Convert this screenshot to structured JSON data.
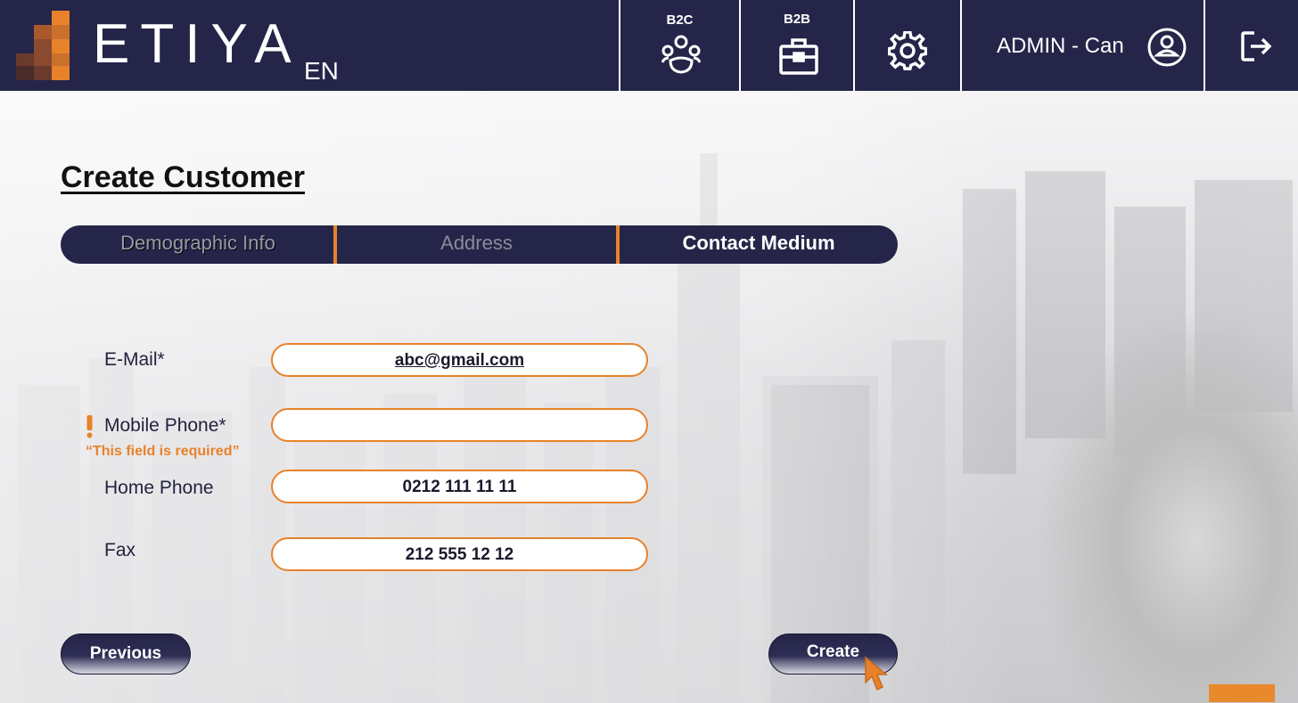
{
  "header": {
    "brand": "ETIYA",
    "language": "EN",
    "nav": {
      "b2c_label": "B2C",
      "b2b_label": "B2B"
    },
    "user_label": "ADMIN - Can",
    "icons": [
      "users-icon",
      "briefcase-icon",
      "gear-icon",
      "user-circle-icon",
      "logout-icon"
    ]
  },
  "page": {
    "title": "Create Customer"
  },
  "steps": [
    {
      "label": "Demographic Info",
      "state": "visited"
    },
    {
      "label": "Address",
      "state": "disabled"
    },
    {
      "label": "Contact Medium",
      "state": "active"
    }
  ],
  "form": {
    "email": {
      "label": "E-Mail*",
      "value": "abc@gmail.com"
    },
    "mobile": {
      "label": "Mobile Phone*",
      "value": "",
      "error": "“This field is required”"
    },
    "home": {
      "label": "Home Phone",
      "value": "0212 111 11 11"
    },
    "fax": {
      "label": "Fax",
      "value": "212 555 12 12"
    }
  },
  "actions": {
    "previous_label": "Previous",
    "create_label": "Create"
  },
  "colors": {
    "navy": "#25254a",
    "accent": "#e8822a"
  }
}
